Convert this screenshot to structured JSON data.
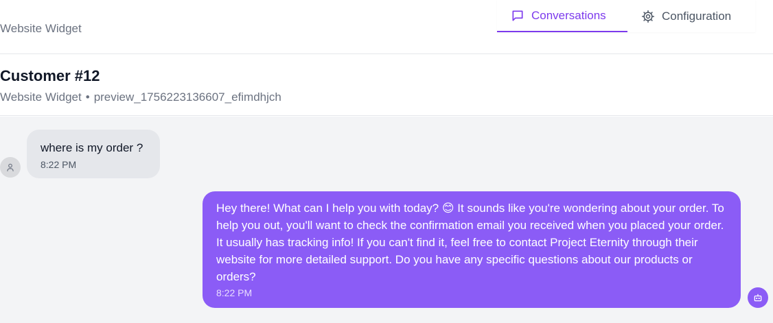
{
  "header": {
    "widget_name": "Website Widget",
    "tabs": [
      {
        "label": "Conversations",
        "icon": "chat-bubble-icon",
        "active": true
      },
      {
        "label": "Configuration",
        "icon": "gear-icon",
        "active": false
      }
    ]
  },
  "conversation": {
    "title": "Customer #12",
    "source": "Website Widget",
    "separator": "•",
    "session_id": "preview_1756223136607_efimdhjch"
  },
  "messages": [
    {
      "role": "user",
      "text": "where is my order ?",
      "time": "8:22 PM",
      "avatar_icon": "user-icon"
    },
    {
      "role": "assistant",
      "text": "Hey there! What can I help you with today? 😊 It sounds like you're wondering about your order. To help you out, you'll want to check the confirmation email you received when you placed your order. It usually has tracking info! If you can't find it, feel free to contact Project Eternity through their website for more detailed support. Do you have any specific questions about our products or orders?",
      "time": "8:22 PM",
      "avatar_icon": "bot-icon"
    }
  ],
  "colors": {
    "accent": "#7c3aed",
    "assistant_bubble": "#8b5cf6",
    "user_bubble": "#e5e7eb",
    "chat_background": "#f3f4f6"
  }
}
